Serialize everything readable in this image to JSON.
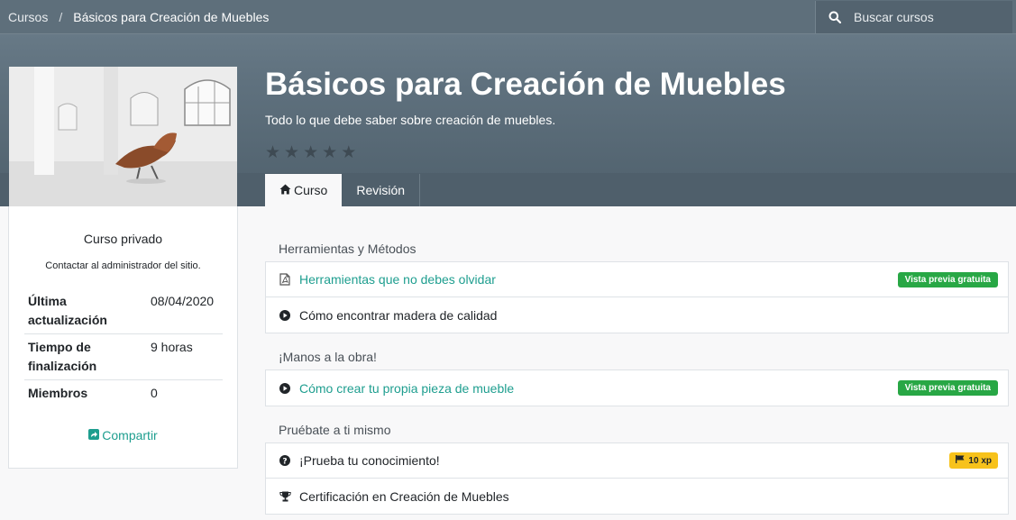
{
  "breadcrumb": {
    "root": "Cursos",
    "separator": "/",
    "current": "Básicos para Creación de Muebles"
  },
  "search": {
    "placeholder": "Buscar cursos"
  },
  "course": {
    "title": "Básicos para Creación de Muebles",
    "subtitle": "Todo lo que debe saber sobre creación de muebles.",
    "rating_stars": 0,
    "rating_max": 5
  },
  "tabs": [
    {
      "label": "Curso",
      "icon": "home-icon",
      "active": true
    },
    {
      "label": "Revisión",
      "active": false
    }
  ],
  "sidebar": {
    "title": "Curso privado",
    "note": "Contactar al administrador del sitio.",
    "info": [
      {
        "label": "Última actualización",
        "value": "08/04/2020"
      },
      {
        "label": "Tiempo de finalización",
        "value": "9 horas"
      },
      {
        "label": "Miembros",
        "value": "0"
      }
    ],
    "share_label": "Compartir"
  },
  "sections": [
    {
      "title": "Herramientas y Métodos",
      "items": [
        {
          "label": "Herramientas que no debes olvidar",
          "icon": "pdf-icon",
          "link": true,
          "badge": "Vista previa gratuita"
        },
        {
          "label": "Cómo encontrar madera de calidad",
          "icon": "play-icon",
          "link": false
        }
      ]
    },
    {
      "title": "¡Manos a la obra!",
      "items": [
        {
          "label": "Cómo crear tu propia pieza de mueble",
          "icon": "play-icon",
          "link": true,
          "badge": "Vista previa gratuita"
        }
      ]
    },
    {
      "title": "Pruébate a ti mismo",
      "items": [
        {
          "label": "¡Prueba tu conocimiento!",
          "icon": "question-icon",
          "link": false,
          "xp": "10 xp"
        },
        {
          "label": "Certificación en Creación de Muebles",
          "icon": "trophy-icon",
          "link": false
        }
      ]
    }
  ],
  "colors": {
    "accent": "#1e9e8f",
    "badge_free": "#28a745",
    "badge_xp": "#f7c21b",
    "header": "#5e6f7b"
  }
}
